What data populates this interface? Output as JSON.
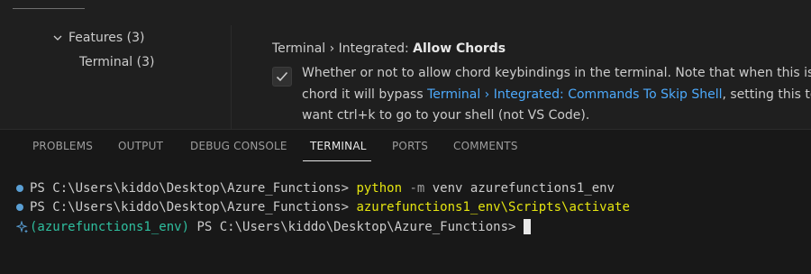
{
  "settings": {
    "toc": {
      "features": "Features (3)",
      "terminal": "Terminal (3)"
    },
    "setting": {
      "title_prefix": "Terminal › Integrated: ",
      "title_name": "Allow Chords",
      "checked": true,
      "desc_line1": "Whether or not to allow chord keybindings in the terminal. Note that when this is",
      "desc_line2_pre": "chord it will bypass ",
      "desc_line2_link": "Terminal › Integrated: Commands To Skip Shell",
      "desc_line2_post": ", setting this to",
      "desc_line3": "want ctrl+k to go to your shell (not VS Code)."
    }
  },
  "panel": {
    "tabs": [
      {
        "label": "PROBLEMS"
      },
      {
        "label": "OUTPUT"
      },
      {
        "label": "DEBUG CONSOLE"
      },
      {
        "label": "TERMINAL",
        "active": true
      },
      {
        "label": "PORTS"
      },
      {
        "label": "COMMENTS"
      }
    ],
    "terminal": {
      "line1": {
        "prompt": "PS C:\\Users\\kiddo\\Desktop\\Azure_Functions> ",
        "cmd": "python",
        "flag": " -m",
        "args": " venv azurefunctions1_env"
      },
      "line2": {
        "prompt": "PS C:\\Users\\kiddo\\Desktop\\Azure_Functions> ",
        "cmd": "azurefunctions1_env\\Scripts\\activate"
      },
      "line3": {
        "env": "(azurefunctions1_env)",
        "prompt": " PS C:\\Users\\kiddo\\Desktop\\Azure_Functions>"
      }
    }
  },
  "colors": {
    "accent": "#4daafc",
    "command": "#e5e510",
    "env": "#2fbf9f",
    "dot": "#5a9fd4"
  }
}
